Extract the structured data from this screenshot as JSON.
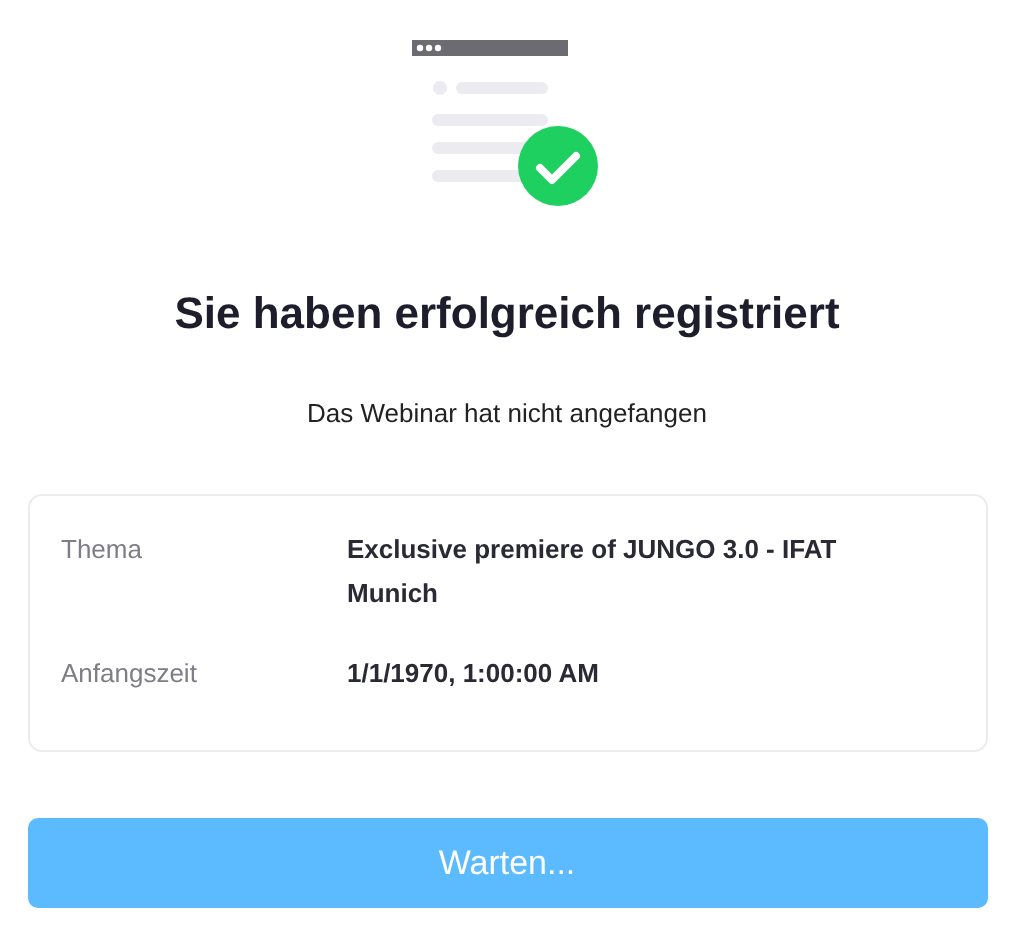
{
  "title": "Sie haben erfolgreich registriert",
  "subtitle": "Das Webinar hat nicht angefangen",
  "details": [
    {
      "label": "Thema",
      "value": "Exclusive premiere of JUNGO 3.0 - IFAT Munich"
    },
    {
      "label": "Anfangszeit",
      "value": "1/1/1970, 1:00:00 AM"
    }
  ],
  "button": {
    "label": "Warten...",
    "disabled": true
  }
}
